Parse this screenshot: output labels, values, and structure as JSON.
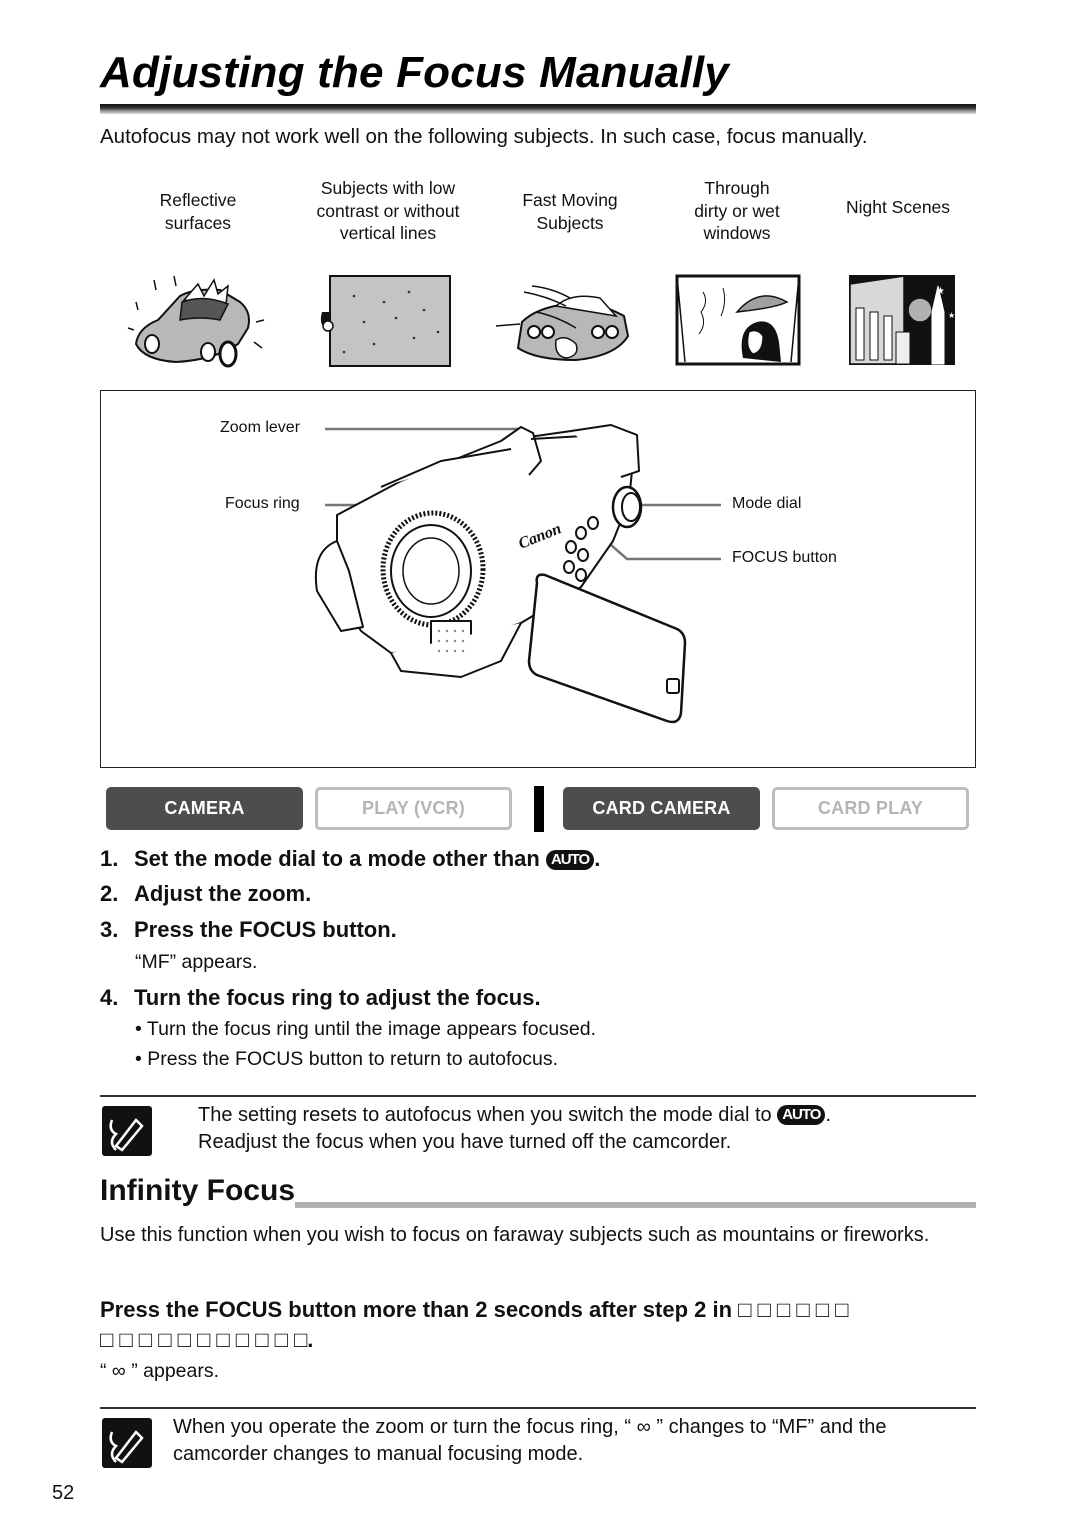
{
  "page": {
    "title": "Adjusting the Focus Manually",
    "intro": "Autofocus may not work well on the following subjects. In such case, focus manually.",
    "page_number": "52"
  },
  "subjects": [
    {
      "label": "Reflective surfaces",
      "lines": [
        "Reflective",
        "surfaces"
      ],
      "icon": "car-icon"
    },
    {
      "label": "Subjects with low contrast or without vertical lines",
      "lines": [
        "Subjects with low",
        "contrast or without",
        "vertical lines"
      ],
      "icon": "wall-icon"
    },
    {
      "label": "Fast Moving Subjects",
      "lines": [
        "Fast Moving",
        "Subjects"
      ],
      "icon": "racing-car-icon"
    },
    {
      "label": "Through dirty or wet windows",
      "lines": [
        "Through",
        "dirty or wet",
        "windows"
      ],
      "icon": "rainy-window-icon"
    },
    {
      "label": "Night Scenes",
      "lines": [
        "Night Scenes"
      ],
      "icon": "night-city-icon"
    }
  ],
  "diagram": {
    "callouts": {
      "zoom_lever": "Zoom lever",
      "focus_ring": "Focus ring",
      "mode_dial": "Mode dial",
      "focus_button": "FOCUS button"
    },
    "brand": "Canon"
  },
  "modes": [
    {
      "label": "CAMERA",
      "active": true
    },
    {
      "label": "PLAY (VCR)",
      "active": false
    },
    {
      "label": "CARD CAMERA",
      "active": true
    },
    {
      "label": "CARD PLAY",
      "active": false
    }
  ],
  "steps": [
    {
      "num": "1.",
      "text": "Set the mode dial to a mode other than",
      "suffix": ".",
      "badge": "AUTO"
    },
    {
      "num": "2.",
      "text": "Adjust the zoom."
    },
    {
      "num": "3.",
      "text": "Press the FOCUS button.",
      "note": "“MF” appears."
    },
    {
      "num": "4.",
      "text": "Turn the focus ring to adjust the focus.",
      "bullets": [
        "Turn the focus ring until the image appears focused.",
        "Press the FOCUS button to return to autofocus."
      ]
    }
  ],
  "note1": {
    "line1": "The setting resets to autofocus when you switch the mode dial to",
    "badge": "AUTO",
    "line1_suffix": ".",
    "line2": "Readjust the focus when you have turned off the camcorder."
  },
  "infinity": {
    "heading": "Infinity Focus",
    "description": "Use this function when you wish to focus on faraway subjects such as mountains or fireworks.",
    "instruction_line1": "Press the FOCUS button more than 2 seconds after step 2 in □ □ □ □ □ □",
    "instruction_line2": "□ □ □ □ □ □ □ □ □ □ □.",
    "result": "“ ∞ ” appears."
  },
  "note2": {
    "line1": "When you operate the zoom or turn the focus ring, “ ∞ ” changes to “MF” and the",
    "line2": "camcorder changes to manual focusing mode."
  },
  "colors": {
    "mode_active_bg": "#4d4d4d",
    "mode_inactive_text": "#b5b5b5",
    "heading_rule": "#b0b0b0"
  }
}
